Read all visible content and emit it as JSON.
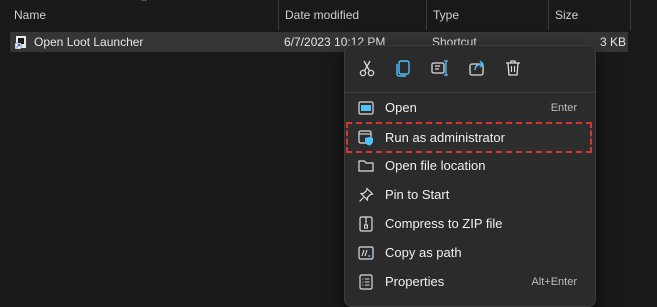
{
  "columns": {
    "name": "Name",
    "date": "Date modified",
    "type": "Type",
    "size": "Size"
  },
  "file": {
    "name": "Open Loot Launcher",
    "date": "6/7/2023 10:12 PM",
    "type": "Shortcut",
    "size": "3 KB",
    "icon": "shortcut-icon"
  },
  "quick_actions": [
    {
      "icon": "cut-icon"
    },
    {
      "icon": "copy-icon"
    },
    {
      "icon": "rename-icon"
    },
    {
      "icon": "share-icon"
    },
    {
      "icon": "delete-icon"
    }
  ],
  "menu_items": [
    {
      "label": "Open",
      "shortcut": "Enter",
      "icon": "open-icon"
    },
    {
      "label": "Run as administrator",
      "shortcut": "",
      "icon": "admin-shield-icon",
      "highlighted": true
    },
    {
      "label": "Open file location",
      "shortcut": "",
      "icon": "folder-icon"
    },
    {
      "label": "Pin to Start",
      "shortcut": "",
      "icon": "pin-icon"
    },
    {
      "label": "Compress to ZIP file",
      "shortcut": "",
      "icon": "zip-icon"
    },
    {
      "label": "Copy as path",
      "shortcut": "",
      "icon": "copy-path-icon"
    },
    {
      "label": "Properties",
      "shortcut": "Alt+Enter",
      "icon": "properties-icon"
    }
  ],
  "colors": {
    "accent": "#4cc2ff",
    "highlight_outline": "#d43636",
    "menu_bg": "#2b2b2b",
    "row_selected": "#353535"
  }
}
